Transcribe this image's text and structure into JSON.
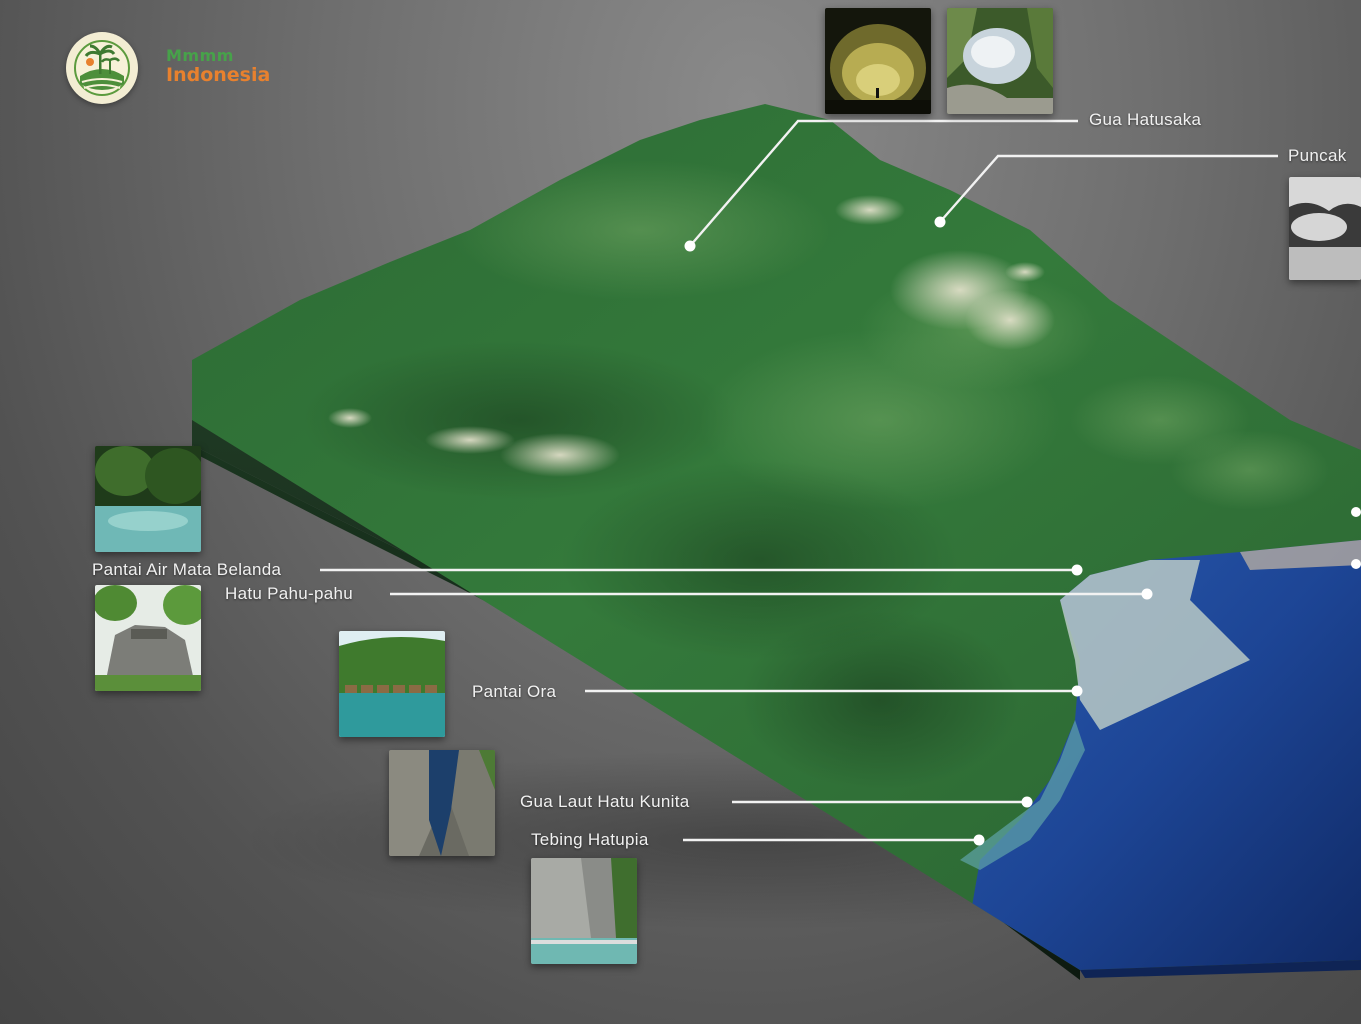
{
  "brand": {
    "top_text": "Mmmm",
    "bottom_text": "Indonesia",
    "logo_icon": "island-palm-logo-icon",
    "colors": {
      "green": "#47a24a",
      "orange": "#e8812e",
      "badge_bg": "#f3edd3"
    }
  },
  "map": {
    "style": "3d-terrain-block",
    "land_color": "#2f6b36",
    "sea_color": "#1b3f8a"
  },
  "locations": [
    {
      "id": "gua-hatusaka",
      "label": "Gua Hatusaka",
      "photos": [
        "cave-interior-photo",
        "cave-sinkhole-photo"
      ]
    },
    {
      "id": "puncak",
      "label": "Puncak",
      "photos": [
        "misty-peak-photo"
      ]
    },
    {
      "id": "pantai-air-mata-belanda",
      "label": "Pantai Air Mata Belanda",
      "photos": [
        "forest-pool-photo"
      ]
    },
    {
      "id": "hatu-pahu-pahu",
      "label": "Hatu Pahu-pahu",
      "photos": [
        "rock-formation-photo"
      ]
    },
    {
      "id": "pantai-ora",
      "label": "Pantai Ora",
      "photos": [
        "overwater-bungalows-photo"
      ]
    },
    {
      "id": "gua-laut-hatu-kunita",
      "label": "Gua Laut Hatu Kunita",
      "photos": [
        "sea-cave-photo"
      ]
    },
    {
      "id": "tebing-hatupia",
      "label": "Tebing Hatupia",
      "photos": [
        "cliff-photo"
      ]
    }
  ]
}
